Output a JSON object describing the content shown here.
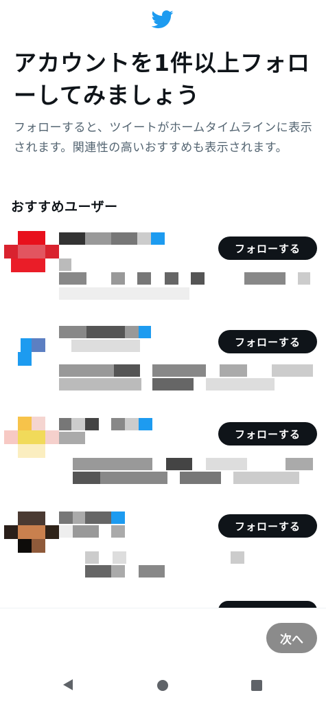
{
  "header": {
    "logo_icon": "twitter-bird-icon",
    "brand_color": "#1d9bf0"
  },
  "title": "アカウントを1件以上フォローしてみましょう",
  "subtitle": "フォローすると、ツイートがホームタイムラインに表示されます。関連性の高いおすすめも表示されます。",
  "section_heading": "おすすめユーザー",
  "suggestions": [
    {
      "follow_label": "フォローする"
    },
    {
      "follow_label": "フォローする"
    },
    {
      "follow_label": "フォローする"
    },
    {
      "follow_label": "フォローする"
    }
  ],
  "footer": {
    "next_label": "次へ"
  },
  "nav": {
    "back_icon": "back-triangle-icon",
    "home_icon": "home-circle-icon",
    "recent_icon": "recents-square-icon"
  }
}
